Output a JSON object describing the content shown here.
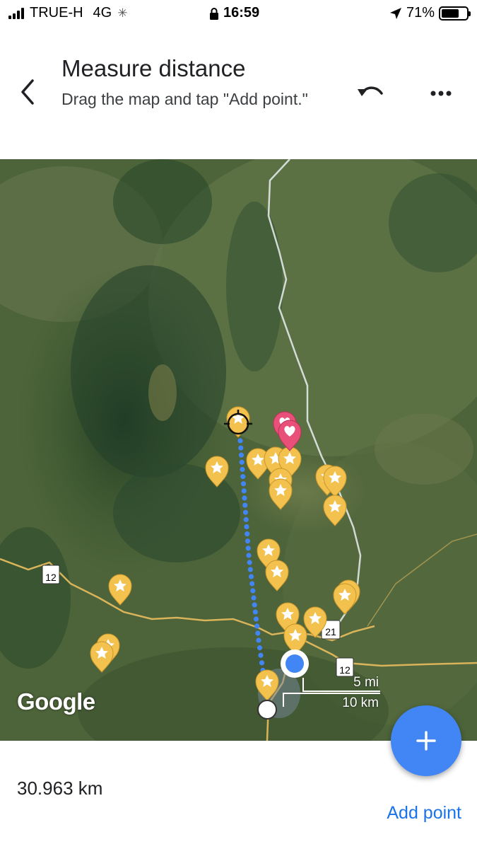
{
  "status_bar": {
    "carrier": "TRUE-H",
    "network": "4G",
    "time": "16:59",
    "battery": "71%",
    "battery_level": 0.71
  },
  "header": {
    "title": "Measure distance",
    "subtitle": "Drag the map and tap \"Add point.\"",
    "back_icon": "chevron-left-icon",
    "undo_icon": "undo-icon",
    "more_icon": "more-horizontal-icon"
  },
  "map": {
    "logo": "Google",
    "scale_mi": "5 mi",
    "scale_km": "10 km",
    "route_shields": [
      "12",
      "21",
      "12"
    ],
    "pin_color": "#f2c14e",
    "heart_pin_color": "#e8507a",
    "route_dot_color": "#4285f4"
  },
  "footer": {
    "distance": "30.963 km",
    "add_point_label": "Add point",
    "fab_icon": "plus-icon",
    "fab_label": "+"
  },
  "colors": {
    "accent": "#1a73e8",
    "fab": "#4285f4"
  }
}
